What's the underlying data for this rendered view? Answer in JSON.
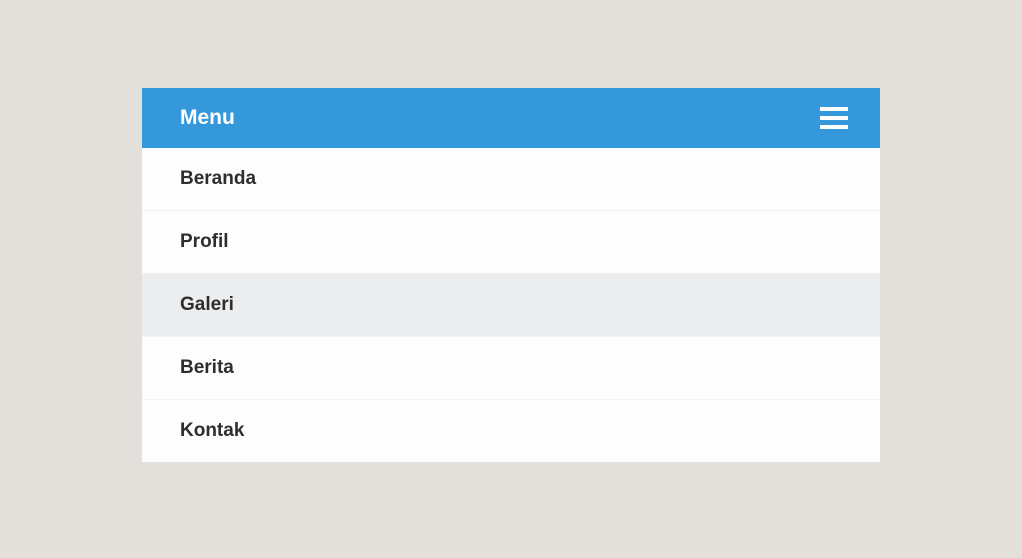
{
  "menu": {
    "title": "Menu",
    "items": [
      {
        "label": "Beranda",
        "hover": false
      },
      {
        "label": "Profil",
        "hover": false
      },
      {
        "label": "Galeri",
        "hover": true
      },
      {
        "label": "Berita",
        "hover": false
      },
      {
        "label": "Kontak",
        "hover": false
      }
    ]
  }
}
